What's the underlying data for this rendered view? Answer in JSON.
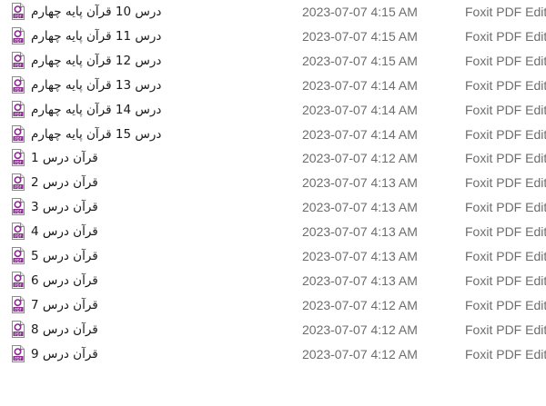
{
  "file_list": {
    "icon_name": "pdf-file-icon",
    "colors": {
      "icon_accent": "#8a2a8f",
      "date_text": "#6d6d6d",
      "name_text": "#1a1a1a"
    },
    "rows": [
      {
        "name": "درس 10 قرآن پایه چهارم",
        "date_modified": "2023-07-07 4:15 AM",
        "type": "Foxit PDF Edit"
      },
      {
        "name": "درس 11 قرآن پایه چهارم",
        "date_modified": "2023-07-07 4:15 AM",
        "type": "Foxit PDF Edit"
      },
      {
        "name": "درس 12 قرآن پایه چهارم",
        "date_modified": "2023-07-07 4:15 AM",
        "type": "Foxit PDF Edit"
      },
      {
        "name": "درس 13 قرآن پایه چهارم",
        "date_modified": "2023-07-07 4:14 AM",
        "type": "Foxit PDF Edit"
      },
      {
        "name": "درس 14 قرآن پایه چهارم",
        "date_modified": "2023-07-07 4:14 AM",
        "type": "Foxit PDF Edit"
      },
      {
        "name": "درس 15 قرآن پایه چهارم",
        "date_modified": "2023-07-07 4:14 AM",
        "type": "Foxit PDF Edit"
      },
      {
        "name": "قرآن درس 1",
        "date_modified": "2023-07-07 4:12 AM",
        "type": "Foxit PDF Edit"
      },
      {
        "name": "قرآن درس 2",
        "date_modified": "2023-07-07 4:13 AM",
        "type": "Foxit PDF Edit"
      },
      {
        "name": "قرآن درس 3",
        "date_modified": "2023-07-07 4:13 AM",
        "type": "Foxit PDF Edit"
      },
      {
        "name": "قرآن درس 4",
        "date_modified": "2023-07-07 4:13 AM",
        "type": "Foxit PDF Edit"
      },
      {
        "name": "قرآن درس 5",
        "date_modified": "2023-07-07 4:13 AM",
        "type": "Foxit PDF Edit"
      },
      {
        "name": "قرآن درس 6",
        "date_modified": "2023-07-07 4:13 AM",
        "type": "Foxit PDF Edit"
      },
      {
        "name": "قرآن درس 7",
        "date_modified": "2023-07-07 4:12 AM",
        "type": "Foxit PDF Edit"
      },
      {
        "name": "قرآن درس 8",
        "date_modified": "2023-07-07 4:12 AM",
        "type": "Foxit PDF Edit"
      },
      {
        "name": "قرآن درس 9",
        "date_modified": "2023-07-07 4:12 AM",
        "type": "Foxit PDF Edit"
      }
    ]
  }
}
